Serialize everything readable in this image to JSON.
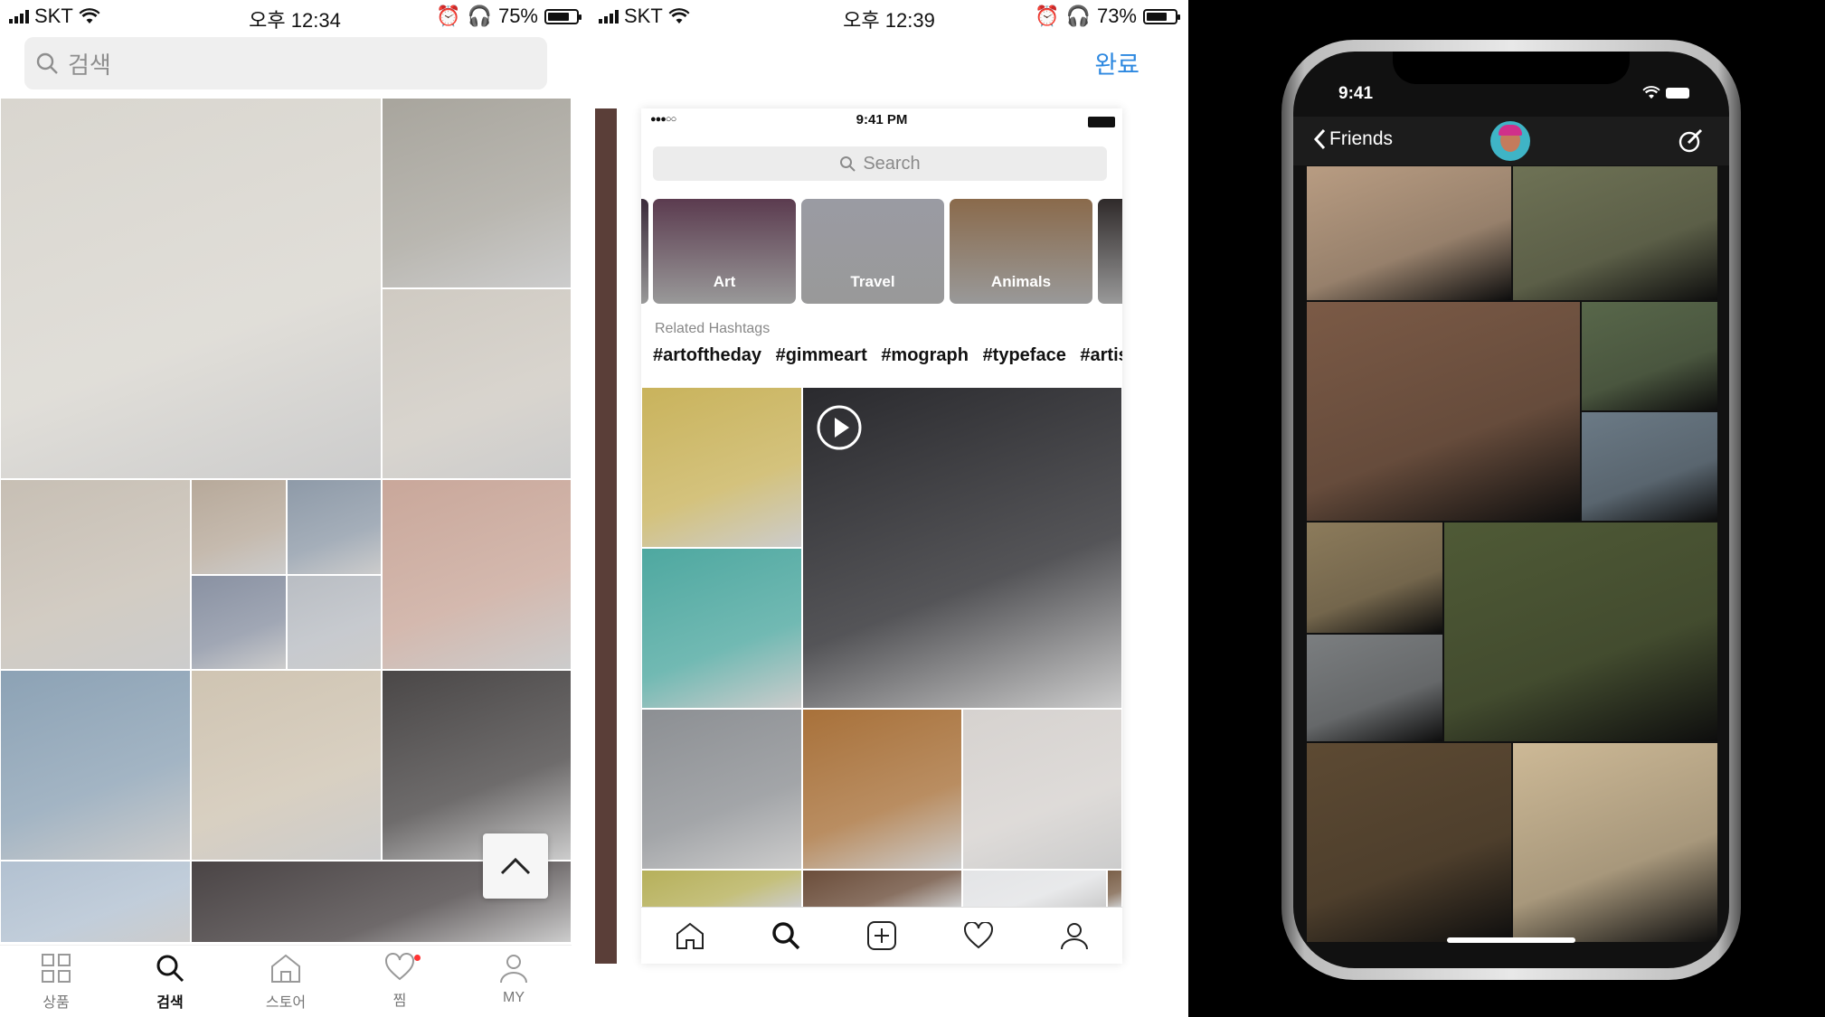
{
  "panel1": {
    "status": {
      "carrier": "SKT",
      "time": "오후 12:34",
      "battery": "75%",
      "battery_level": 0.75
    },
    "search": {
      "placeholder": "검색"
    },
    "tabs": [
      {
        "label": "상품",
        "icon": "grid-icon",
        "active": false
      },
      {
        "label": "검색",
        "icon": "search-icon",
        "active": true
      },
      {
        "label": "스토어",
        "icon": "store-icon",
        "active": false
      },
      {
        "label": "찜",
        "icon": "heart-icon",
        "active": false,
        "badge": true
      },
      {
        "label": "MY",
        "icon": "person-icon",
        "active": false
      }
    ],
    "photos": [
      {
        "name": "photo-linen-pants",
        "color": "#d9d6cf"
      },
      {
        "name": "photo-orange-top-jeans",
        "color": "#a8a59d"
      },
      {
        "name": "photo-cream-dress-flowers",
        "color": "#cfcac2"
      },
      {
        "name": "photo-white-pants-bench",
        "color": "#c7bfb4"
      },
      {
        "name": "photo-brown-dress",
        "color": "#b7a99a"
      },
      {
        "name": "photo-blue-dress",
        "color": "#8e9aa8"
      },
      {
        "name": "photo-plaid-dress",
        "color": "#8991a2"
      },
      {
        "name": "photo-skirt-mirror",
        "color": "#b9bdc3"
      },
      {
        "name": "photo-pink-knit-dress",
        "color": "#c9a79a"
      },
      {
        "name": "photo-blue-jeans",
        "color": "#8ca2b5"
      },
      {
        "name": "photo-beige-knit-dress",
        "color": "#cfc4b2"
      },
      {
        "name": "photo-black-tshirt",
        "color": "#4a4747"
      },
      {
        "name": "photo-light-jeans",
        "color": "#b2c1d1"
      },
      {
        "name": "photo-black-cardigan",
        "color": "#4a4445"
      }
    ]
  },
  "panel2": {
    "status": {
      "carrier": "SKT",
      "time": "오후 12:39",
      "battery": "73%",
      "battery_level": 0.73
    },
    "done_label": "완료",
    "screen": {
      "time": "9:41 PM",
      "search_placeholder": "Search",
      "categories": [
        {
          "label": "",
          "color": "#3a2a3a"
        },
        {
          "label": "Art",
          "color": "#5b3b4f"
        },
        {
          "label": "Travel",
          "color": "#9a9ba3"
        },
        {
          "label": "Animals",
          "color": "#8a6a4b"
        },
        {
          "label": "",
          "color": "#2f2a2a"
        }
      ],
      "related_title": "Related Hashtags",
      "hashtags": [
        "#artoftheday",
        "#gimmeart",
        "#mograph",
        "#typeface",
        "#artis"
      ],
      "photos": [
        {
          "name": "photo-paint-palette",
          "color": "#c9b35c"
        },
        {
          "name": "photo-spin-art-video",
          "color": "#2a2a2e",
          "video": true
        },
        {
          "name": "photo-neon-drawing",
          "color": "#4ea8a0"
        },
        {
          "name": "photo-koi-fish",
          "color": "#8c8f93"
        },
        {
          "name": "photo-lego-robot",
          "color": "#a8713a"
        },
        {
          "name": "photo-face-painting",
          "color": "#d6d2cf"
        },
        {
          "name": "photo-bottom-a",
          "color": "#b6b05a"
        },
        {
          "name": "photo-bottom-b",
          "color": "#6b4d3a"
        },
        {
          "name": "photo-bottom-c",
          "color": "#e3e4e6"
        },
        {
          "name": "photo-bottom-d",
          "color": "#7a5f48"
        }
      ],
      "tabs": [
        "home-icon",
        "search-icon",
        "add-icon",
        "heart-icon",
        "person-icon"
      ]
    }
  },
  "panel3": {
    "time": "9:41",
    "back_label": "Friends",
    "photos": [
      {
        "name": "photo-beach-walk",
        "color": "#b89c82"
      },
      {
        "name": "photo-man-scarf",
        "color": "#6e7255"
      },
      {
        "name": "photo-smiling-woman",
        "color": "#7b5a46"
      },
      {
        "name": "photo-picnic-table",
        "color": "#58674a"
      },
      {
        "name": "photo-coast-hikers",
        "color": "#6b7a86"
      },
      {
        "name": "photo-meadow-blanket",
        "color": "#8c7b5b"
      },
      {
        "name": "photo-forest-friends",
        "color": "#4f5a36"
      },
      {
        "name": "photo-rocky-sea",
        "color": "#7b7e80"
      },
      {
        "name": "photo-woman-headscarf",
        "color": "#5d4a33"
      },
      {
        "name": "photo-sand-dune-couple",
        "color": "#cdb996"
      }
    ]
  }
}
